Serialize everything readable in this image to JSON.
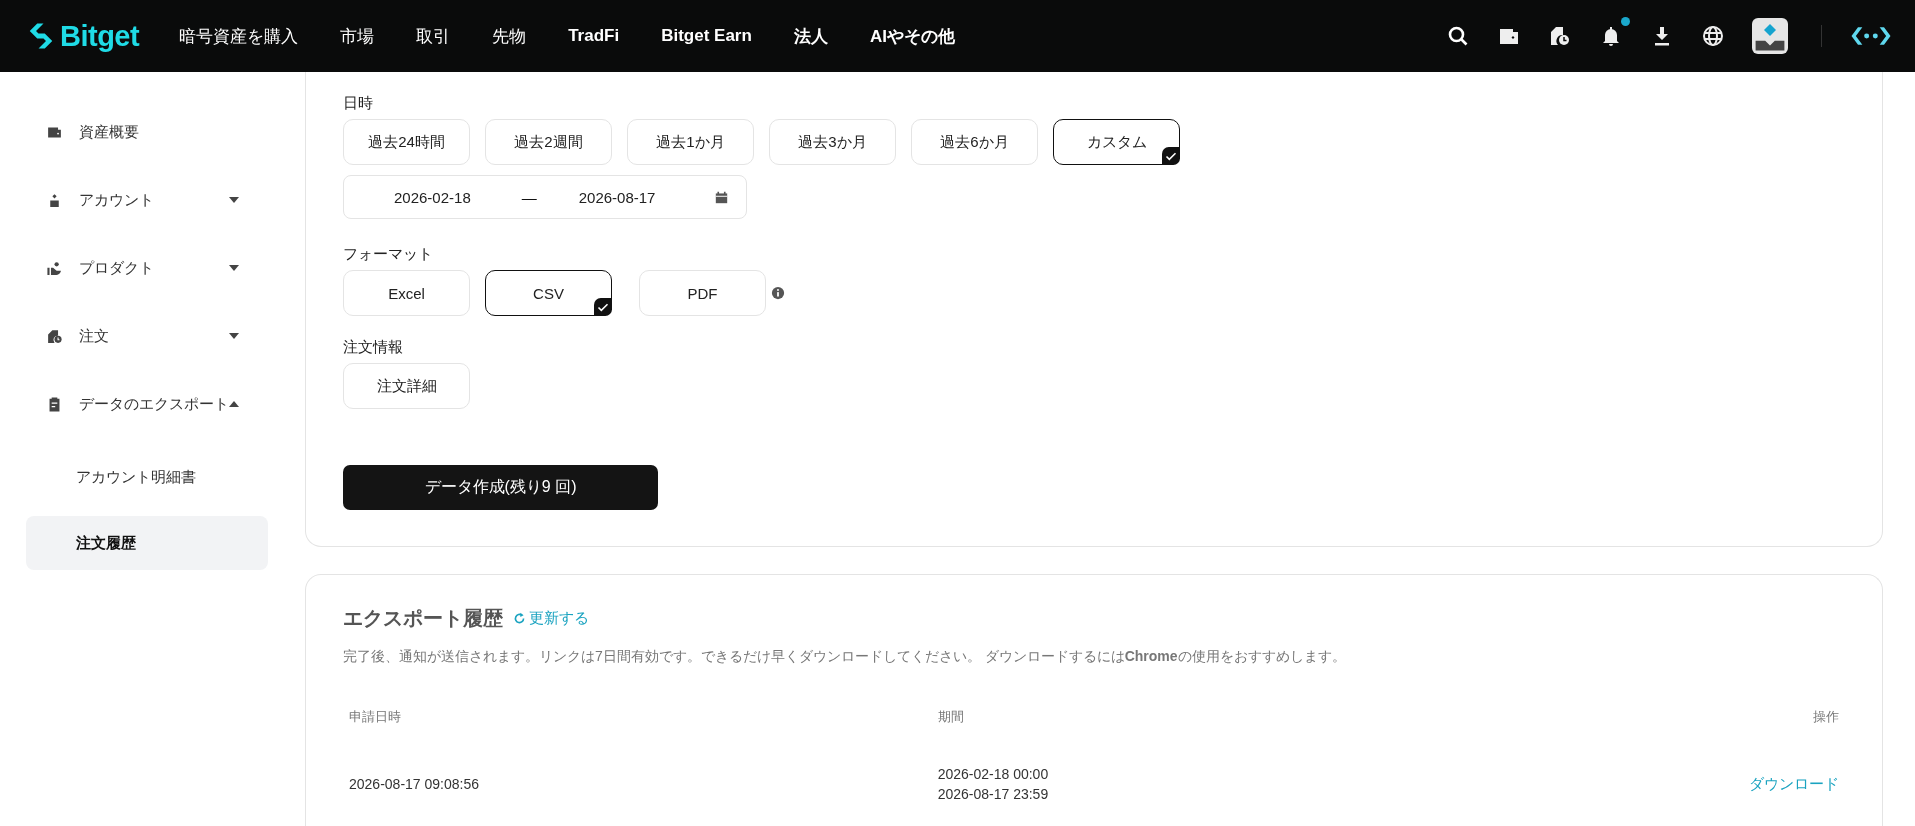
{
  "nav": {
    "logo": "Bitget",
    "items": [
      "暗号資産を購入",
      "市場",
      "取引",
      "先物",
      "TradFi",
      "Bitget Earn",
      "法人",
      "AIやその他"
    ],
    "notification_dot": true
  },
  "sidebar": {
    "items": [
      {
        "label": "資産概要"
      },
      {
        "label": "アカウント",
        "expanded": false
      },
      {
        "label": "プロダクト",
        "expanded": false
      },
      {
        "label": "注文",
        "expanded": false
      },
      {
        "label": "データのエクスポート",
        "expanded": true,
        "children": [
          {
            "label": "アカウント明細書",
            "selected": false
          },
          {
            "label": "注文履歴",
            "selected": true
          }
        ]
      }
    ]
  },
  "export_form": {
    "date": {
      "label": "日時",
      "options": [
        {
          "label": "過去24時間",
          "selected": false
        },
        {
          "label": "過去2週間",
          "selected": false
        },
        {
          "label": "過去1か月",
          "selected": false
        },
        {
          "label": "過去3か月",
          "selected": false
        },
        {
          "label": "過去6か月",
          "selected": false
        },
        {
          "label": "カスタム",
          "selected": true
        }
      ],
      "range": {
        "start": "2026-02-18",
        "separator": "—",
        "end": "2026-08-17"
      }
    },
    "format": {
      "label": "フォーマット",
      "options": [
        {
          "label": "Excel",
          "selected": false
        },
        {
          "label": "CSV",
          "selected": true
        },
        {
          "label": "PDF",
          "selected": false,
          "info": true
        }
      ]
    },
    "order_info": {
      "label": "注文情報",
      "options": [
        {
          "label": "注文詳細",
          "selected": false
        }
      ]
    },
    "submit": "データ作成(残り9 回)"
  },
  "export_history": {
    "title": "エクスポート履歴",
    "refresh": "更新する",
    "note": "完了後、通知が送信されます。リンクは7日間有効です。できるだけ早くダウンロードしてください。 ダウンロードするには**Chrome**の使用をおすすめします。",
    "table": {
      "columns": [
        "申請日時",
        "期間",
        "操作"
      ],
      "rows": [
        {
          "requested": "2026-08-17 09:08:56",
          "period": [
            "2026-02-18 00:00",
            "2026-08-17 23:59"
          ],
          "action": "ダウンロード"
        }
      ]
    }
  }
}
